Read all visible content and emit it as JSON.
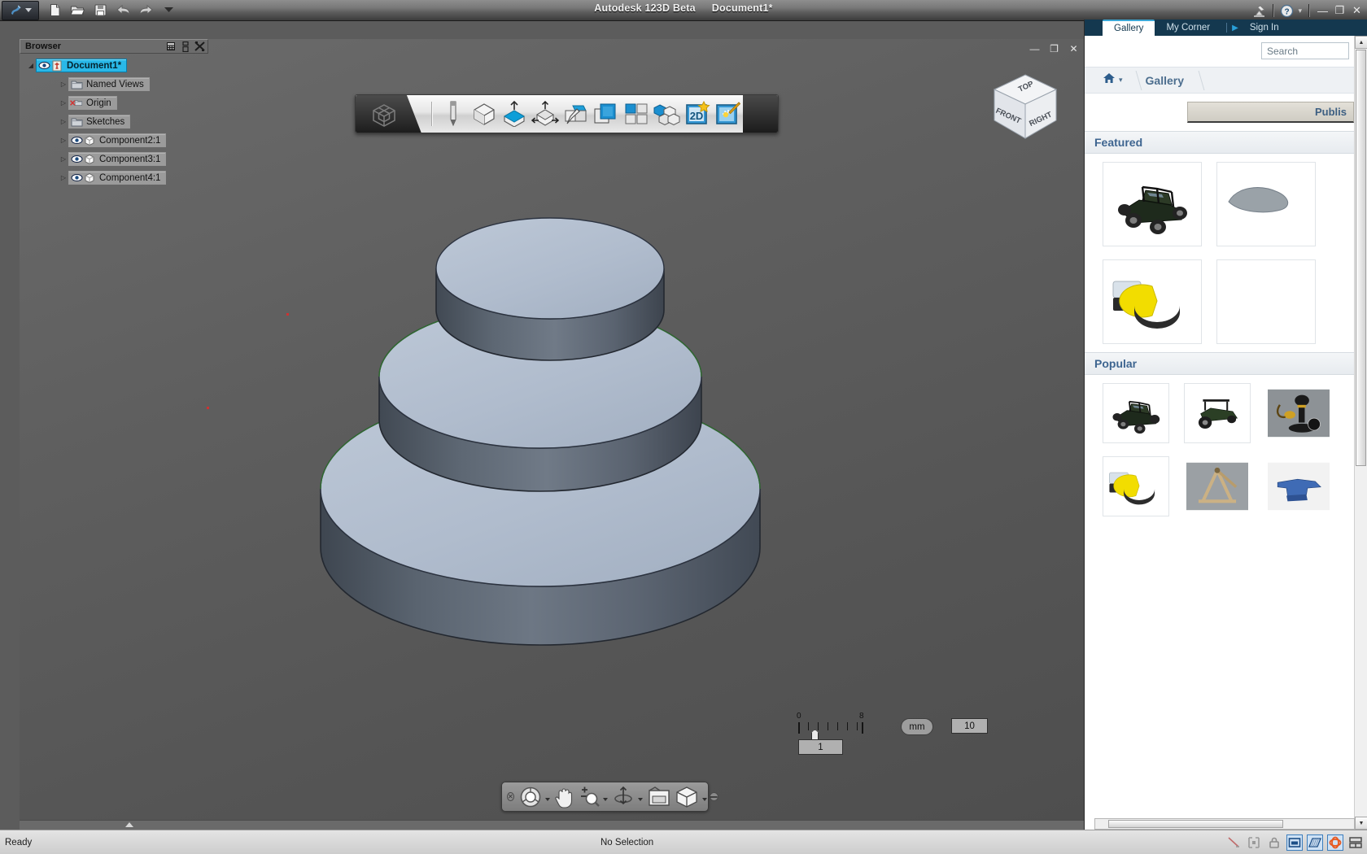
{
  "window": {
    "app_title": "Autodesk 123D Beta",
    "document_title": "Document1*",
    "minimize": "—",
    "restore": "❐",
    "close": "✕",
    "help_icon": "help-circle-icon",
    "help_caret": "▾",
    "app_menu_caret": "▾"
  },
  "quick_access": {
    "items": [
      {
        "name": "new-document",
        "icon": "page-icon"
      },
      {
        "name": "open-document",
        "icon": "folder-open-icon"
      },
      {
        "name": "save-document",
        "icon": "floppy-disk-icon"
      },
      {
        "name": "undo",
        "icon": "undo-arrow-icon"
      },
      {
        "name": "redo",
        "icon": "redo-arrow-icon"
      },
      {
        "name": "customize-quick-access",
        "icon": "chevron-down-icon"
      }
    ]
  },
  "browser": {
    "title": "Browser",
    "header_buttons": [
      {
        "name": "browser-filter",
        "icon": "grid-list-icon"
      },
      {
        "name": "browser-dock",
        "icon": "dock-icon"
      },
      {
        "name": "browser-close",
        "icon": "close-x-icon"
      }
    ],
    "tree": [
      {
        "label": "Document1*",
        "icon": "document-pin-icon",
        "selected": true,
        "depth": 0,
        "expander": "◢",
        "eye": true
      },
      {
        "label": "Named Views",
        "icon": "folder-icon",
        "selected": false,
        "depth": 1,
        "expander": "▷",
        "eye": false
      },
      {
        "label": "Origin",
        "icon": "folder-hidden-icon",
        "selected": false,
        "depth": 1,
        "expander": "▷",
        "eye": false
      },
      {
        "label": "Sketches",
        "icon": "folder-icon",
        "selected": false,
        "depth": 1,
        "expander": "▷",
        "eye": false
      },
      {
        "label": "Component2:1",
        "icon": "component-cube-icon",
        "selected": false,
        "depth": 1,
        "expander": "▷",
        "eye": true
      },
      {
        "label": "Component3:1",
        "icon": "component-cube-icon",
        "selected": false,
        "depth": 1,
        "expander": "▷",
        "eye": true
      },
      {
        "label": "Component4:1",
        "icon": "component-cube-icon",
        "selected": false,
        "depth": 1,
        "expander": "▷",
        "eye": true
      }
    ]
  },
  "viewport": {
    "controls": {
      "minimize": "—",
      "restore": "❐",
      "close": "✕"
    },
    "toolbar": {
      "tab_icon": "workspace-cube-icon",
      "tools": [
        {
          "name": "sketch-pencil-tool",
          "icon": "pencil-icon"
        },
        {
          "name": "primitive-box-tool",
          "icon": "cube-icon"
        },
        {
          "name": "extrude-tool",
          "icon": "cube-up-arrow-icon"
        },
        {
          "name": "move-tool",
          "icon": "cube-move-arrows-icon"
        },
        {
          "name": "modify-tool",
          "icon": "cube-pencil-icon"
        },
        {
          "name": "combine-tool",
          "icon": "overlapping-squares-icon"
        },
        {
          "name": "pattern-tool",
          "icon": "four-squares-icon"
        },
        {
          "name": "assemble-tool",
          "icon": "cube-group-icon"
        },
        {
          "name": "2d-drawing-tool",
          "icon": "2d-star-icon"
        },
        {
          "name": "render-tool",
          "icon": "magic-wand-sparkle-icon"
        }
      ]
    },
    "viewcube": {
      "top": "TOP",
      "front": "FRONT",
      "right": "RIGHT"
    },
    "scale": {
      "tick_min_label": "0",
      "tick_max_label": "8",
      "units": "mm",
      "zoom_value": "10",
      "scale_value": "1"
    },
    "navbar": {
      "close_glyph": "✕",
      "grip_glyph": "–",
      "tools": [
        {
          "name": "steering-wheel-tool",
          "icon": "steering-wheel-icon",
          "dropdown": true
        },
        {
          "name": "pan-tool",
          "icon": "hand-icon",
          "dropdown": false
        },
        {
          "name": "zoom-tool",
          "icon": "zoom-magnifier-icon",
          "dropdown": true
        },
        {
          "name": "orbit-tool",
          "icon": "orbit-arrows-icon",
          "dropdown": true
        },
        {
          "name": "look-at-tool",
          "icon": "look-at-icon",
          "dropdown": false
        },
        {
          "name": "show-motion-tool",
          "icon": "view-cube-solid-icon",
          "dropdown": true
        }
      ]
    },
    "model": {
      "description": "three-tier stepped cylinder solid",
      "top_face_color": "#b2bfd0",
      "side_color": "#5b6572",
      "edge_highlight_color": "#3a7b3a"
    }
  },
  "gallery": {
    "tabs": [
      {
        "label": "Gallery",
        "active": true
      },
      {
        "label": "My Corner",
        "active": false
      }
    ],
    "play_glyph": "▶",
    "sign_in": "Sign In",
    "search_placeholder": "Search",
    "breadcrumb": {
      "home_icon": "home-icon",
      "caret": "▾",
      "label": "Gallery"
    },
    "publish_label": "Publis",
    "sections": [
      {
        "title": "Featured",
        "thumbs": [
          {
            "name": "gallery-thumb-jeep",
            "kind": "jeep"
          },
          {
            "name": "gallery-thumb-partial",
            "kind": "blob"
          },
          {
            "name": "gallery-thumb-pacman",
            "kind": "pacman"
          },
          {
            "name": "gallery-thumb-partial2",
            "kind": "blank"
          }
        ]
      },
      {
        "title": "Popular",
        "thumbs": [
          {
            "name": "gallery-thumb-jeep-2",
            "kind": "jeep"
          },
          {
            "name": "gallery-thumb-tractor",
            "kind": "tractor"
          },
          {
            "name": "gallery-thumb-telephone",
            "kind": "telephone"
          },
          {
            "name": "gallery-thumb-pacman-2",
            "kind": "pacman"
          },
          {
            "name": "gallery-thumb-catapult",
            "kind": "catapult"
          },
          {
            "name": "gallery-thumb-anvil",
            "kind": "anvil"
          }
        ]
      }
    ]
  },
  "statusbar": {
    "ready": "Ready",
    "selection": "No Selection",
    "icons": [
      {
        "name": "measure-icon",
        "active": false
      },
      {
        "name": "select-window-icon",
        "active": false
      },
      {
        "name": "lock-icon",
        "active": false
      },
      {
        "name": "display-mode-icon",
        "active": true
      },
      {
        "name": "ground-plane-icon",
        "active": true
      },
      {
        "name": "orbit-center-icon",
        "active": true
      },
      {
        "name": "layout-panels-icon",
        "active": false
      }
    ]
  }
}
